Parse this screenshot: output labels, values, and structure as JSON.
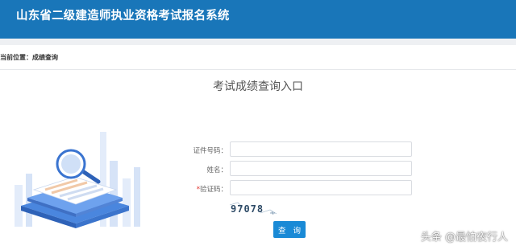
{
  "header": {
    "title": "山东省二级建造师执业资格考试报名系统",
    "bg_color": "#1976b9"
  },
  "breadcrumb": {
    "prefix": "当前位置：",
    "current": "成绩查询"
  },
  "main": {
    "heading": "考试成绩查询入口",
    "form": {
      "id_label": "证件号码：",
      "name_label": "姓名：",
      "captcha_required_mark": "*",
      "captcha_label": "验证码：",
      "id_value": "",
      "name_value": "",
      "captcha_value": "",
      "captcha_image_text": "97078",
      "submit_label": "查 询"
    }
  },
  "watermark": "头条 @最怕夜行人",
  "colors": {
    "accent": "#1a8ad6",
    "required": "#e0302a"
  }
}
